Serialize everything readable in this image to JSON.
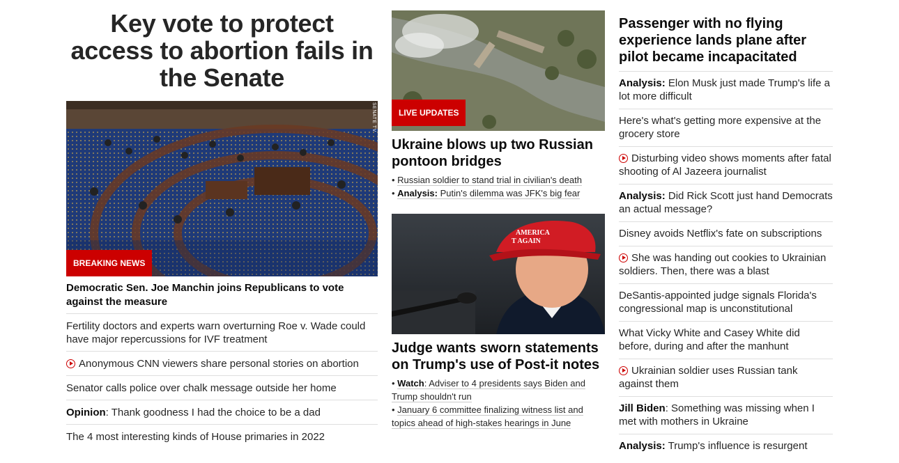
{
  "lead": {
    "headline": "Key vote to protect access to abortion fails in the Senate",
    "badge": "BREAKING NEWS",
    "image_credit": "SENATE TV",
    "subheadline": "Democratic Sen. Joe Manchin joins Republicans to vote against the measure",
    "items": [
      {
        "prefix": "",
        "text": "Fertility doctors and experts warn overturning Roe v. Wade could have major repercussions for IVF treatment",
        "video": false
      },
      {
        "prefix": "",
        "text": "Anonymous CNN viewers share personal stories on abortion",
        "video": true
      },
      {
        "prefix": "",
        "text": "Senator calls police over chalk message outside her home",
        "video": false
      },
      {
        "prefix": "Opinion",
        "text": ": Thank goodness I had the choice to be a dad",
        "video": false
      },
      {
        "prefix": "",
        "text": "The 4 most interesting kinds of House primaries in 2022",
        "video": false
      }
    ]
  },
  "ukraine": {
    "badge": "LIVE UPDATES",
    "headline": "Ukraine blows up two Russian pontoon bridges",
    "bullets": [
      {
        "prefix": "",
        "text": "Russian soldier to stand trial in civilian's death"
      },
      {
        "prefix": "Analysis:",
        "text": " Putin's dilemma was JFK's big fear"
      }
    ]
  },
  "judge": {
    "hat_text_1": "AMERICA",
    "hat_text_2": "T AGAIN",
    "headline": "Judge wants sworn statements on Trump's use of Post-it notes",
    "bullets": [
      {
        "prefix": "Watch",
        "text": ": Adviser to 4 presidents says Biden and Trump shouldn't run"
      },
      {
        "prefix": "",
        "text": "January 6 committee finalizing witness list and topics ahead of high-stakes hearings in June"
      }
    ]
  },
  "right": {
    "headline": "Passenger with no flying experience lands plane after pilot became incapacitated",
    "items": [
      {
        "prefix": "Analysis:",
        "text": " Elon Musk just made Trump's life a lot more difficult",
        "video": false
      },
      {
        "prefix": "",
        "text": "Here's what's getting more expensive at the grocery store",
        "video": false
      },
      {
        "prefix": "",
        "text": "Disturbing video shows moments after fatal shooting of Al Jazeera journalist",
        "video": true
      },
      {
        "prefix": "Analysis:",
        "text": " Did Rick Scott just hand Democrats an actual message?",
        "video": false
      },
      {
        "prefix": "",
        "text": "Disney avoids Netflix's fate on subscriptions",
        "video": false
      },
      {
        "prefix": "",
        "text": "She was handing out cookies to Ukrainian soldiers. Then, there was a blast",
        "video": true
      },
      {
        "prefix": "",
        "text": "DeSantis-appointed judge signals Florida's congressional map is unconstitutional",
        "video": false
      },
      {
        "prefix": "",
        "text": "What Vicky White and Casey White did before, during and after the manhunt",
        "video": false
      },
      {
        "prefix": "",
        "text": "Ukrainian soldier uses Russian tank against them",
        "video": true
      },
      {
        "prefix": "Jill Biden",
        "text": ": Something was missing when I met with mothers in Ukraine",
        "video": false
      },
      {
        "prefix": "Analysis:",
        "text": " Trump's influence is resurgent",
        "video": false
      }
    ]
  },
  "colors": {
    "accent_red": "#cc0000",
    "divider": "#dedede",
    "text": "#262626"
  }
}
